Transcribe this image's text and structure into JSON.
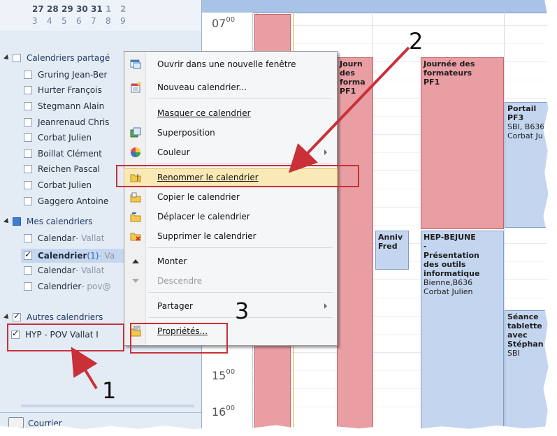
{
  "mini_calendar": {
    "row1": [
      "27",
      "28",
      "29",
      "30",
      "31",
      "1",
      "2"
    ],
    "row2": [
      "3",
      "4",
      "5",
      "6",
      "7",
      "8",
      "9"
    ]
  },
  "nav": {
    "shared_group": {
      "label": "Calendriers partagé",
      "items": [
        "Gruring Jean-Ber",
        "Hurter François",
        "Stegmann Alain",
        "Jeanrenaud Chris",
        "Corbat Julien",
        "Boillat Clément",
        "Reichen Pascal",
        "Corbat Julien",
        "Gaggero Antoine"
      ]
    },
    "mine_group": {
      "label": "Mes calendriers",
      "items": [
        {
          "name": "Calendar",
          "suffix": " - Vallat",
          "checked": false
        },
        {
          "name": "Calendrier",
          "count": " (1)",
          "suffix": " - Va",
          "checked": true,
          "selected": true
        },
        {
          "name": "Calendar",
          "suffix": " - Vallat",
          "checked": false
        },
        {
          "name": "Calendrier",
          "suffix": " - pov@",
          "checked": false
        }
      ]
    },
    "other_group": {
      "label": "Autres calendriers",
      "items": [
        {
          "name": "HYP - POV Vallat I",
          "checked": true
        }
      ]
    },
    "bottom_label": "Courrier"
  },
  "calendar": {
    "hours": [
      {
        "h": "07",
        "m": "00"
      },
      {
        "h": "15",
        "m": "00"
      },
      {
        "h": "16",
        "m": "00"
      }
    ],
    "appointments": [
      {
        "lines": [
          "Journ",
          "des",
          "forma",
          "PF1"
        ]
      },
      {
        "lines": [
          "Journée des",
          "formateurs",
          "PF1"
        ]
      },
      {
        "lines": [
          "Portail",
          "PF3",
          "SBI, B636",
          "Corbat Ju"
        ]
      },
      {
        "lines": [
          "Anniv",
          "Fred"
        ]
      },
      {
        "lines": [
          "HEP-BEJUNE",
          "-",
          "Présentation",
          "des outils",
          "informatique",
          "Bienne,B636",
          "Corbat Julien"
        ]
      },
      {
        "lines": [
          "Séance",
          "tablette",
          "avec",
          "Stéphan",
          "SBI"
        ]
      }
    ]
  },
  "context_menu": {
    "items": [
      {
        "label": "Ouvrir dans une nouvelle fenêtre",
        "icon": "new-window-icon"
      },
      {
        "label": "Nouveau calendrier...",
        "icon": "new-calendar-icon"
      },
      {
        "label": "Masquer ce calendrier",
        "icon": ""
      },
      {
        "label": "Superposition",
        "icon": "overlay-icon"
      },
      {
        "label": "Couleur",
        "icon": "color-wheel-icon",
        "submenu": true
      },
      {
        "label": "Renommer le calendrier",
        "icon": "rename-folder-icon",
        "highlighted": true
      },
      {
        "label": "Copier le calendrier",
        "icon": "copy-folder-icon"
      },
      {
        "label": "Déplacer le calendrier",
        "icon": "move-folder-icon"
      },
      {
        "label": "Supprimer le calendrier",
        "icon": "delete-folder-icon"
      },
      {
        "label": "Monter",
        "icon": "up-arrow-icon"
      },
      {
        "label": "Descendre",
        "icon": "down-arrow-icon",
        "disabled": true
      },
      {
        "label": "Partager",
        "icon": "",
        "submenu": true
      },
      {
        "label": "Propriétés...",
        "icon": "properties-icon"
      }
    ]
  },
  "annotations": {
    "step1": "1",
    "step2": "2",
    "step3": "3",
    "color": "#c93038"
  }
}
